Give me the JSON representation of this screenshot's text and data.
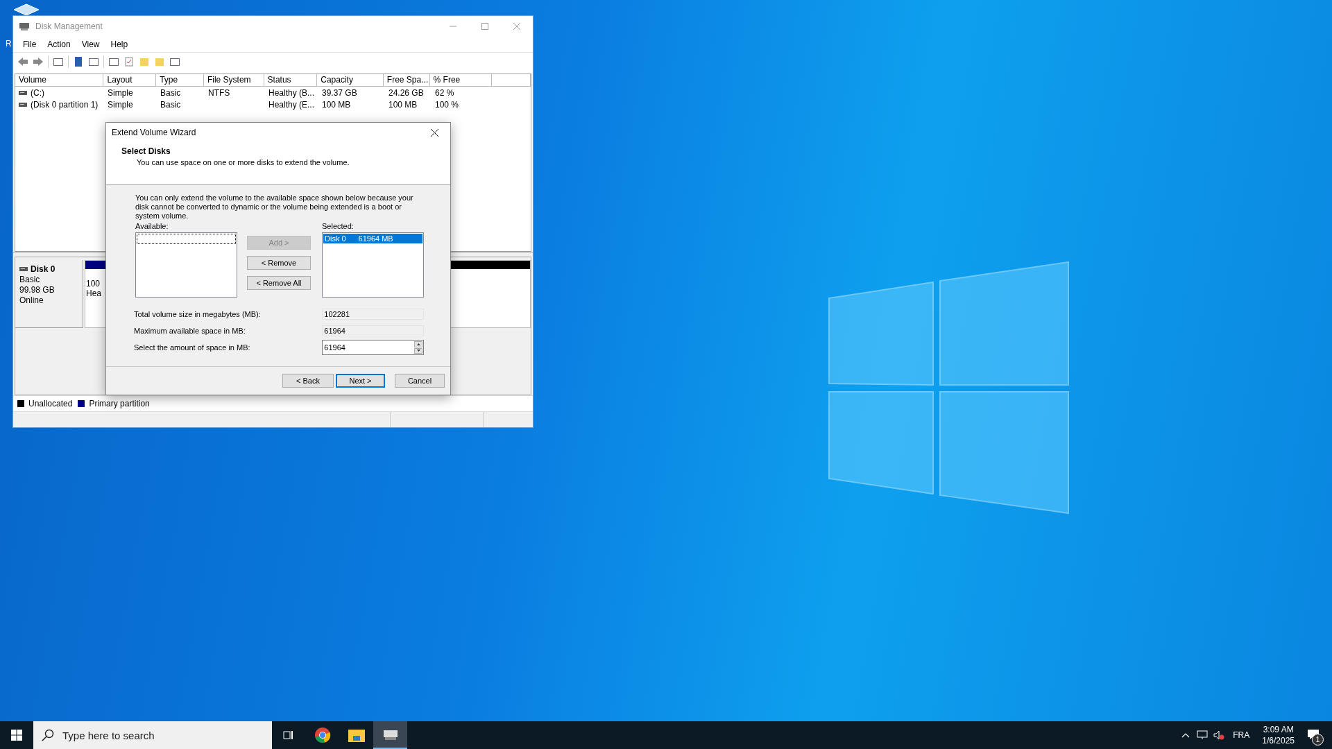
{
  "desktop": {
    "icon_label": "R"
  },
  "window": {
    "title": "Disk Management",
    "menu": [
      "File",
      "Action",
      "View",
      "Help"
    ],
    "columns": [
      "Volume",
      "Layout",
      "Type",
      "File System",
      "Status",
      "Capacity",
      "Free Spa...",
      "% Free"
    ],
    "rows": [
      {
        "cells": [
          "(C:)",
          "Simple",
          "Basic",
          "NTFS",
          "Healthy (B...",
          "39.37 GB",
          "24.26 GB",
          "62 %"
        ]
      },
      {
        "cells": [
          "(Disk 0 partition 1)",
          "Simple",
          "Basic",
          "",
          "Healthy (E...",
          "100 MB",
          "100 MB",
          "100 %"
        ]
      }
    ],
    "disk": {
      "name": "Disk 0",
      "type": "Basic",
      "size": "99.98 GB",
      "status": "Online",
      "partition_lines": [
        "100",
        "Hea"
      ]
    },
    "legend": [
      {
        "label": "Unallocated",
        "color": "#000000"
      },
      {
        "label": "Primary partition",
        "color": "#000080"
      }
    ]
  },
  "dialog": {
    "title": "Extend Volume Wizard",
    "heading": "Select Disks",
    "subheading": "You can use space on one or more disks to extend the volume.",
    "note": "You can only extend the volume to the available space shown below because your disk cannot be converted to dynamic or the volume being extended is a boot or system volume.",
    "available_label": "Available:",
    "selected_label": "Selected:",
    "move_buttons": [
      {
        "label": "Add >",
        "disabled": true
      },
      {
        "label": "< Remove",
        "disabled": false
      },
      {
        "label": "< Remove All",
        "disabled": false
      }
    ],
    "selected_items": [
      {
        "disk": "Disk 0",
        "size": "61964 MB",
        "selected": true
      }
    ],
    "fields": [
      {
        "label": "Total volume size in megabytes (MB):",
        "value": "102281",
        "kind": "readonly"
      },
      {
        "label": "Maximum available space in MB:",
        "value": "61964",
        "kind": "readonly"
      },
      {
        "label": "Select the amount of space in MB:",
        "value": "61964",
        "kind": "spinner"
      }
    ],
    "buttons": [
      {
        "label": "< Back",
        "default": false
      },
      {
        "label": "Next >",
        "default": true
      },
      {
        "label": "Cancel",
        "default": false
      }
    ]
  },
  "taskbar": {
    "search_placeholder": "Type here to search",
    "language": "FRA",
    "time": "3:09 AM",
    "date": "1/6/2025",
    "notification_count": "1"
  }
}
